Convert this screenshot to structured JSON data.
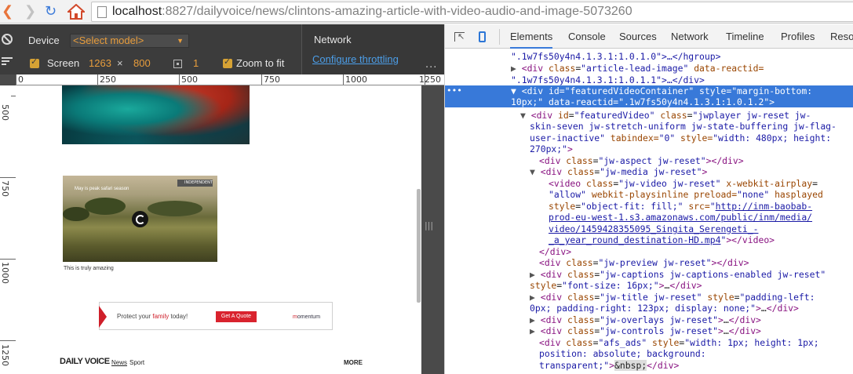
{
  "browser": {
    "url_host": "localhost",
    "url_path": ":8827/dailyvoice/news/clintons-amazing-article-with-video-audio-and-image-5073260"
  },
  "emulation": {
    "device_label": "Device",
    "model_placeholder": "<Select model>",
    "screen_label": "Screen",
    "width": "1263",
    "times": "×",
    "height": "800",
    "scale": "1",
    "zoom_label": "Zoom to fit",
    "network_label": "Network",
    "throttle_link": "Configure throttling",
    "ruler_h": [
      "0",
      "250",
      "500",
      "750",
      "1000",
      "1250"
    ],
    "ruler_v": [
      "500",
      "750",
      "1000",
      "1250"
    ]
  },
  "page": {
    "video_title": "May is peak safari season",
    "badge": "INDEPENDENT",
    "caption": "This is truly amazing",
    "ad_text_pre": "Protect your ",
    "ad_text_em": "family",
    "ad_text_post": " today!",
    "ad_button": "Get A Quote",
    "ad_logo_m": "m",
    "ad_logo_rest": "omentum",
    "site_name": "DAILY VOICE",
    "nav_news": "News",
    "nav_sport": "Sport",
    "nav_more": "MORE"
  },
  "devtools": {
    "tabs": [
      "Elements",
      "Console",
      "Sources",
      "Network",
      "Timeline",
      "Profiles",
      "Reso"
    ]
  },
  "dom": {
    "l1_close": ".1w7fs50y4n4.1.3.1:1.0.1.0\">…</hgroup>",
    "l2_cls": "article-lead-image",
    "l2_react": "data-reactid=",
    "l3": "\".1w7fs50y4n4.1.3.1:1.0.1.1\">…</div>",
    "sel_a_id": "featuredVideoContainer",
    "sel_a_style": "\"margin-bottom:",
    "sel_b": "10px;\" data-reactid=\".1w7fs50y4n4.1.3.1:1.0.1.2\">",
    "fv_id": "featuredVideo",
    "fv_cls1": "\"jwplayer jw-reset jw-",
    "fv_cls2": "skin-seven jw-stretch-uniform jw-state-buffering jw-flag-",
    "fv_cls3": "user-inactive\"",
    "fv_tab": "tabindex=",
    "fv_tab_v": "\"0\"",
    "fv_style": "style=",
    "fv_style_v": "\"width: 480px; height:",
    "fv_style_v2": "270px;\"",
    "aspect_cls": "\"jw-aspect jw-reset\"",
    "media_cls": "\"jw-media jw-reset\"",
    "video_cls": "\"jw-video jw-reset\"",
    "video_air": "x-webkit-airplay",
    "video_allow": "\"allow\"",
    "video_inline": "webkit-playsinline",
    "video_preload": "preload=",
    "video_none": "\"none\"",
    "video_hasplayed": "hasplayed",
    "video_style": "\"object-fit: fill;\"",
    "video_src_attr": "src=",
    "video_src1": "http://inm-baobab-",
    "video_src2": "prod-eu-west-1.s3.amazonaws.com/public/inm/media/",
    "video_src3": "video/1459428355095_Singita_Serengeti_-",
    "video_src4": "_a_year_round_destination-HD.mp4",
    "preview_cls": "\"jw-preview jw-reset\"",
    "captions_cls": "\"jw-captions jw-captions-enabled jw-reset\"",
    "captions_style": "\"font-size: 16px;\"",
    "title_cls": "\"jw-title jw-reset\"",
    "title_style1": "\"padding-left:",
    "title_style2": "0px; padding-right: 123px; display: none;\"",
    "overlays_cls": "\"jw-overlays jw-reset\"",
    "controls_cls": "\"jw-controls jw-reset\"",
    "afs_cls": "\"afs_ads\"",
    "afs_style1": "\"width: 1px; height: 1px;",
    "afs_style2": "position: absolute; background:",
    "afs_style3": "transparent;\"",
    "nbsp": "&nbsp;"
  }
}
